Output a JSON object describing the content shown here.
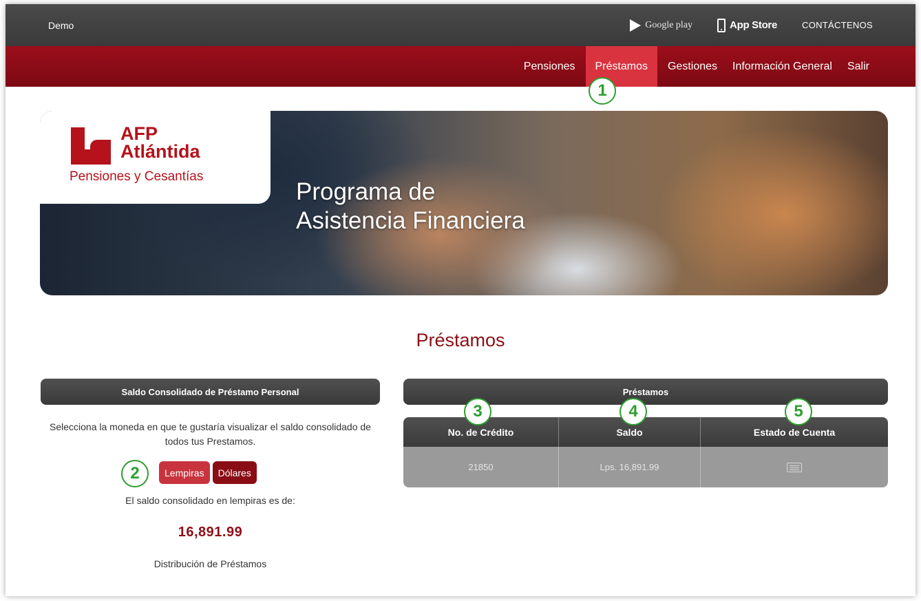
{
  "topbar": {
    "brand": "Demo",
    "google_play": "Google play",
    "app_store": "App Store",
    "contact": "CONTÁCTENOS"
  },
  "nav": {
    "items": [
      "Pensiones",
      "Préstamos",
      "Gestiones",
      "Información General",
      "Salir"
    ],
    "active": "Préstamos"
  },
  "banner": {
    "logo_title_line1": "AFP",
    "logo_title_line2": "Atlántida",
    "logo_subtitle": "Pensiones y Cesantías",
    "title_line1": "Programa de",
    "title_line2": "Asistencia Financiera"
  },
  "page_title": "Préstamos",
  "left_panel": {
    "header": "Saldo Consolidado de Préstamo Personal",
    "description": "Selecciona la moneda en que te gustaría visualizar el saldo consolidado de todos tus Prestamos.",
    "btn_lempiras": "Lempiras",
    "btn_dolares": "Dólares",
    "saldo_label": "El saldo consolidado en lempiras es de:",
    "saldo_value": "16,891.99",
    "distribution_label": "Distribución de Préstamos"
  },
  "right_panel": {
    "header": "Préstamos",
    "columns": [
      "No. de Crédito",
      "Saldo",
      "Estado de Cuenta"
    ],
    "rows": [
      {
        "credit_no": "21850",
        "saldo": "Lps. 16,891.99",
        "statement_icon": "statement-icon"
      }
    ]
  },
  "callouts": [
    "1",
    "2",
    "3",
    "4",
    "5"
  ],
  "colors": {
    "brand_red": "#b5121b",
    "nav_red": "#8e0f17",
    "active_nav": "#d9333f",
    "callout_green": "#2e9e2e"
  }
}
